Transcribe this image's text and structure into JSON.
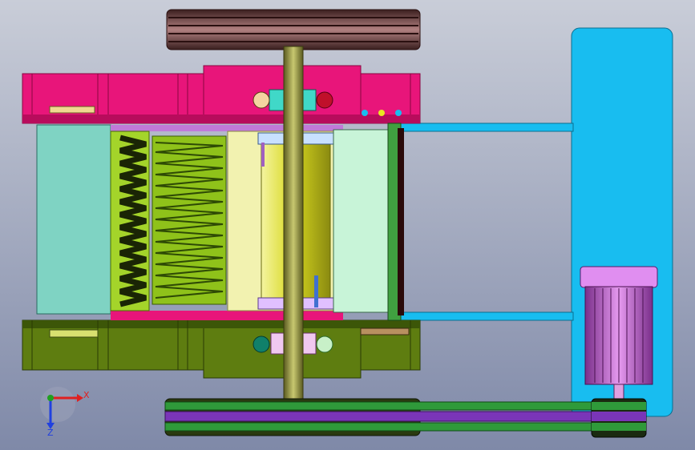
{
  "viewport": {
    "background_top": "#c9cdd8",
    "background_bottom": "#7f89a8"
  },
  "colors": {
    "frame_magenta": "#e8157a",
    "frame_magenta_dark": "#b80c5c",
    "base_olive": "#5e7d10",
    "base_olive_dark": "#3c5608",
    "motor_bracket_blue": "#18bdf0",
    "motor_purple": "#d77ee8",
    "rotor_yellow": "#e0e030",
    "shaft_olive": "#9a9a3a",
    "belt_green": "#2f9a3a",
    "belt_purple": "#7a35b8",
    "pulley_brown": "#6e3c3c",
    "stator_teal": "#7fd3c3",
    "bellows_green": "#8fc21a"
  },
  "icons": {
    "axis_triad": "coordinate-triad-icon"
  },
  "axis_triad": {
    "x_label": "X",
    "z_label": "Z",
    "x_color": "#e02020",
    "z_color": "#2040e0",
    "y_color": "#20a020"
  }
}
